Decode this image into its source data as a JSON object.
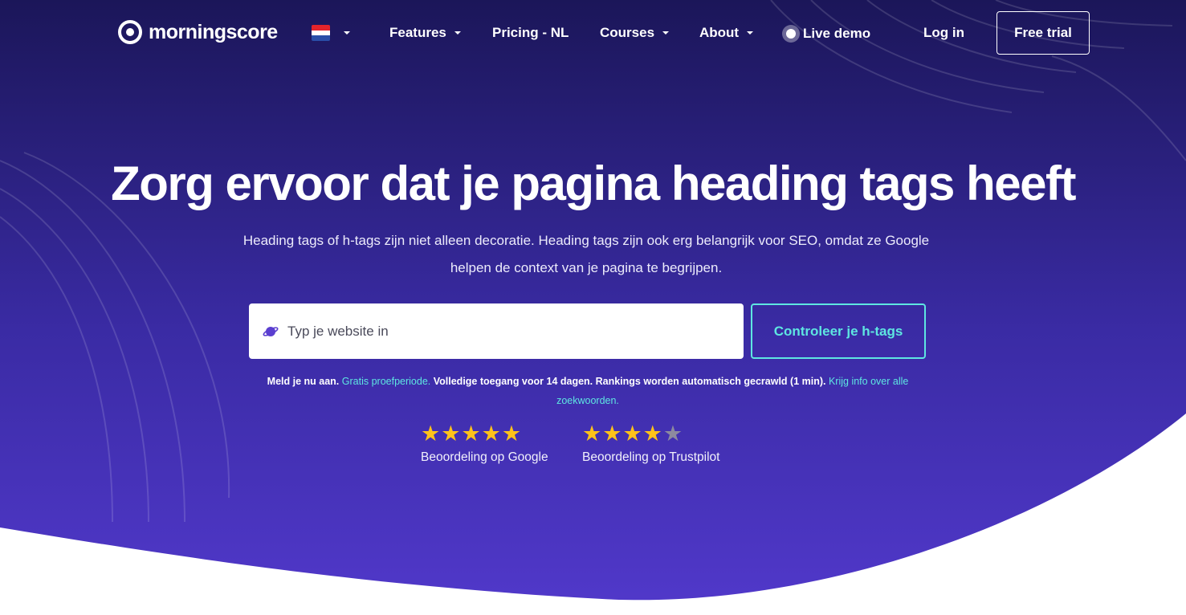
{
  "brand": {
    "name": "morningscore"
  },
  "nav": {
    "language_flag": "NL",
    "items": [
      {
        "label": "Features",
        "has_dropdown": true
      },
      {
        "label": "Pricing - NL",
        "has_dropdown": false
      },
      {
        "label": "Courses",
        "has_dropdown": true
      },
      {
        "label": "About",
        "has_dropdown": true
      }
    ],
    "live_demo": "Live demo",
    "login": "Log in",
    "free_trial": "Free trial"
  },
  "hero": {
    "headline": "Zorg ervoor dat je pagina heading tags heeft",
    "subtitle": "Heading tags of h-tags zijn niet alleen decoratie. Heading tags zijn ook erg belangrijk voor SEO, omdat ze Google helpen de context van je pagina te begrijpen.",
    "search": {
      "placeholder": "Typ je website in",
      "value": ""
    },
    "check_button": "Controleer je h-tags",
    "note": {
      "part1": "Meld je nu aan.",
      "link1": "Gratis proefperiode.",
      "part2": "Volledige toegang voor 14 dagen. Rankings worden automatisch gecrawld (1 min).",
      "link2": "Krijg info over alle zoekwoorden."
    },
    "ratings": [
      {
        "label": "Beoordeling op Google",
        "stars": 5,
        "max": 5
      },
      {
        "label": "Beoordeling op Trustpilot",
        "stars": 4,
        "max": 5
      }
    ]
  },
  "colors": {
    "hero_top": "#1b1659",
    "hero_bottom": "#4f3bc8",
    "accent": "#5ee6e1",
    "star": "#ffc21a"
  }
}
